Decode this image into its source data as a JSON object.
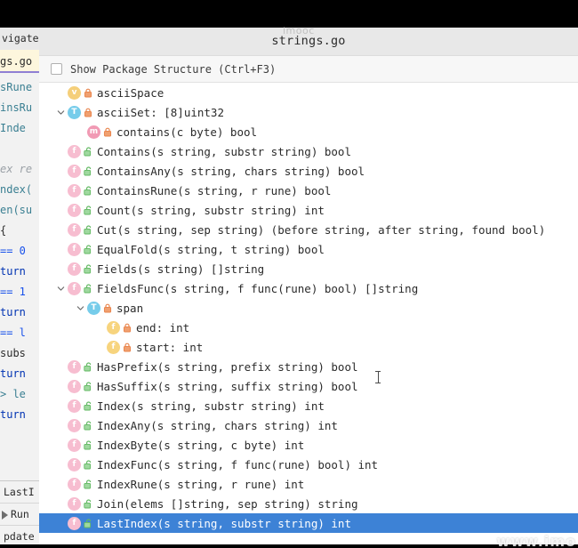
{
  "window": {
    "popup_title": "strings.go",
    "watermark_top": "imooc",
    "watermark_bottom": "www.imo"
  },
  "toolbar": {
    "checkbox_label": "Show Package Structure (Ctrl+F3)",
    "checkbox_checked": false
  },
  "ide": {
    "menu_fragment": "vigate",
    "tab_fragment": "gs.go",
    "code_lines": [
      "sRune",
      "insRu",
      "Inde",
      "",
      "ex re",
      "ndex(",
      "en(su",
      "{",
      "== 0",
      "turn",
      "== 1",
      "turn",
      "== l",
      "subs",
      "turn",
      "> le",
      "turn"
    ],
    "bottom_items": [
      "LastI",
      "Run",
      "pdate"
    ]
  },
  "tree": {
    "rows": [
      {
        "label": "asciiSpace",
        "kind": "v",
        "lock": "closed",
        "indent": 0,
        "twisty": "none",
        "selected": false
      },
      {
        "label": "asciiSet: [8]uint32",
        "kind": "t",
        "lock": "closed",
        "indent": 0,
        "twisty": "down",
        "selected": false
      },
      {
        "label": "contains(c byte) bool",
        "kind": "m",
        "lock": "closed",
        "indent": 1,
        "twisty": "none",
        "selected": false
      },
      {
        "label": "Contains(s string, substr string) bool",
        "kind": "f",
        "lock": "open",
        "indent": 0,
        "twisty": "none",
        "selected": false
      },
      {
        "label": "ContainsAny(s string, chars string) bool",
        "kind": "f",
        "lock": "open",
        "indent": 0,
        "twisty": "none",
        "selected": false
      },
      {
        "label": "ContainsRune(s string, r rune) bool",
        "kind": "f",
        "lock": "open",
        "indent": 0,
        "twisty": "none",
        "selected": false
      },
      {
        "label": "Count(s string, substr string) int",
        "kind": "f",
        "lock": "open",
        "indent": 0,
        "twisty": "none",
        "selected": false
      },
      {
        "label": "Cut(s string, sep string) (before string, after string, found bool)",
        "kind": "f",
        "lock": "open",
        "indent": 0,
        "twisty": "none",
        "selected": false
      },
      {
        "label": "EqualFold(s string, t string) bool",
        "kind": "f",
        "lock": "open",
        "indent": 0,
        "twisty": "none",
        "selected": false
      },
      {
        "label": "Fields(s string) []string",
        "kind": "f",
        "lock": "open",
        "indent": 0,
        "twisty": "none",
        "selected": false
      },
      {
        "label": "FieldsFunc(s string, f func(rune) bool) []string",
        "kind": "f",
        "lock": "open",
        "indent": 0,
        "twisty": "down",
        "selected": false
      },
      {
        "label": "span",
        "kind": "t",
        "lock": "closed",
        "indent": 1,
        "twisty": "down",
        "selected": false
      },
      {
        "label": "end: int",
        "kind": "fy",
        "lock": "closed",
        "indent": 2,
        "twisty": "none",
        "selected": false
      },
      {
        "label": "start: int",
        "kind": "fy",
        "lock": "closed",
        "indent": 2,
        "twisty": "none",
        "selected": false
      },
      {
        "label": "HasPrefix(s string, prefix string) bool",
        "kind": "f",
        "lock": "open",
        "indent": 0,
        "twisty": "none",
        "selected": false
      },
      {
        "label": "HasSuffix(s string, suffix string) bool",
        "kind": "f",
        "lock": "open",
        "indent": 0,
        "twisty": "none",
        "selected": false
      },
      {
        "label": "Index(s string, substr string) int",
        "kind": "f",
        "lock": "open",
        "indent": 0,
        "twisty": "none",
        "selected": false
      },
      {
        "label": "IndexAny(s string, chars string) int",
        "kind": "f",
        "lock": "open",
        "indent": 0,
        "twisty": "none",
        "selected": false
      },
      {
        "label": "IndexByte(s string, c byte) int",
        "kind": "f",
        "lock": "open",
        "indent": 0,
        "twisty": "none",
        "selected": false
      },
      {
        "label": "IndexFunc(s string, f func(rune) bool) int",
        "kind": "f",
        "lock": "open",
        "indent": 0,
        "twisty": "none",
        "selected": false
      },
      {
        "label": "IndexRune(s string, r rune) int",
        "kind": "f",
        "lock": "open",
        "indent": 0,
        "twisty": "none",
        "selected": false
      },
      {
        "label": "Join(elems []string, sep string) string",
        "kind": "f",
        "lock": "open",
        "indent": 0,
        "twisty": "none",
        "selected": false
      },
      {
        "label": "LastIndex(s string, substr string) int",
        "kind": "f",
        "lock": "open",
        "indent": 0,
        "twisty": "none",
        "selected": true
      }
    ]
  },
  "colors": {
    "selection_blue": "#3d82d6",
    "icon_variable": "#f5cf7a",
    "icon_type": "#76ccea",
    "icon_method": "#f19ab4",
    "icon_function": "#f7bdd0",
    "icon_field": "#f7d47e",
    "lock_private": "#e8834a",
    "lock_public": "#62b862",
    "title_bar": "#e8e8e8"
  }
}
